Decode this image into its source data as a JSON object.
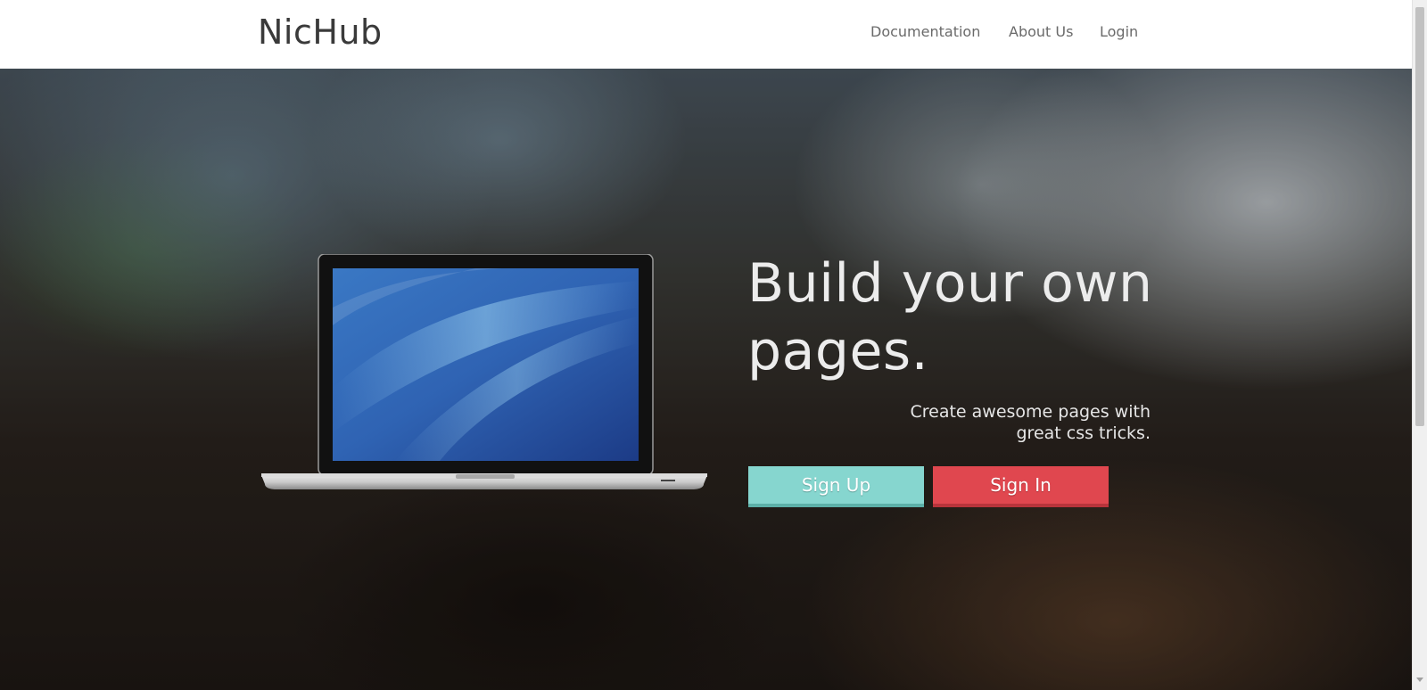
{
  "nav": {
    "brand": "NicHub",
    "links": [
      "Documentation",
      "About Us",
      "Login"
    ]
  },
  "hero": {
    "headline": "Build your own pages.",
    "tagline_line1": "Create awesome pages with",
    "tagline_line2": "great css tricks.",
    "signup_label": "Sign Up",
    "signin_label": "Sign In"
  },
  "colors": {
    "signup": "#86d6cf",
    "signin": "#e0474f",
    "brand_text": "#3a3a3a"
  },
  "icons": {
    "laptop": "laptop-image"
  }
}
